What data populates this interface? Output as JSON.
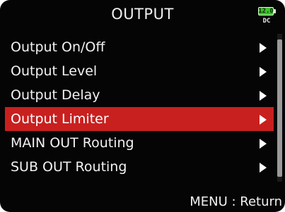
{
  "header": {
    "title": "OUTPUT",
    "battery": {
      "value": "12.0",
      "source": "DC"
    }
  },
  "menu": {
    "items": [
      {
        "label": "Output On/Off",
        "selected": false
      },
      {
        "label": "Output Level",
        "selected": false
      },
      {
        "label": "Output Delay",
        "selected": false
      },
      {
        "label": "Output Limiter",
        "selected": true
      },
      {
        "label": "MAIN OUT Routing",
        "selected": false
      },
      {
        "label": "SUB OUT Routing",
        "selected": false
      }
    ]
  },
  "footer": {
    "hint": "MENU : Return"
  },
  "colors": {
    "selected": "#c8201f",
    "background": "#050505",
    "battery": "#3fbf2f"
  }
}
